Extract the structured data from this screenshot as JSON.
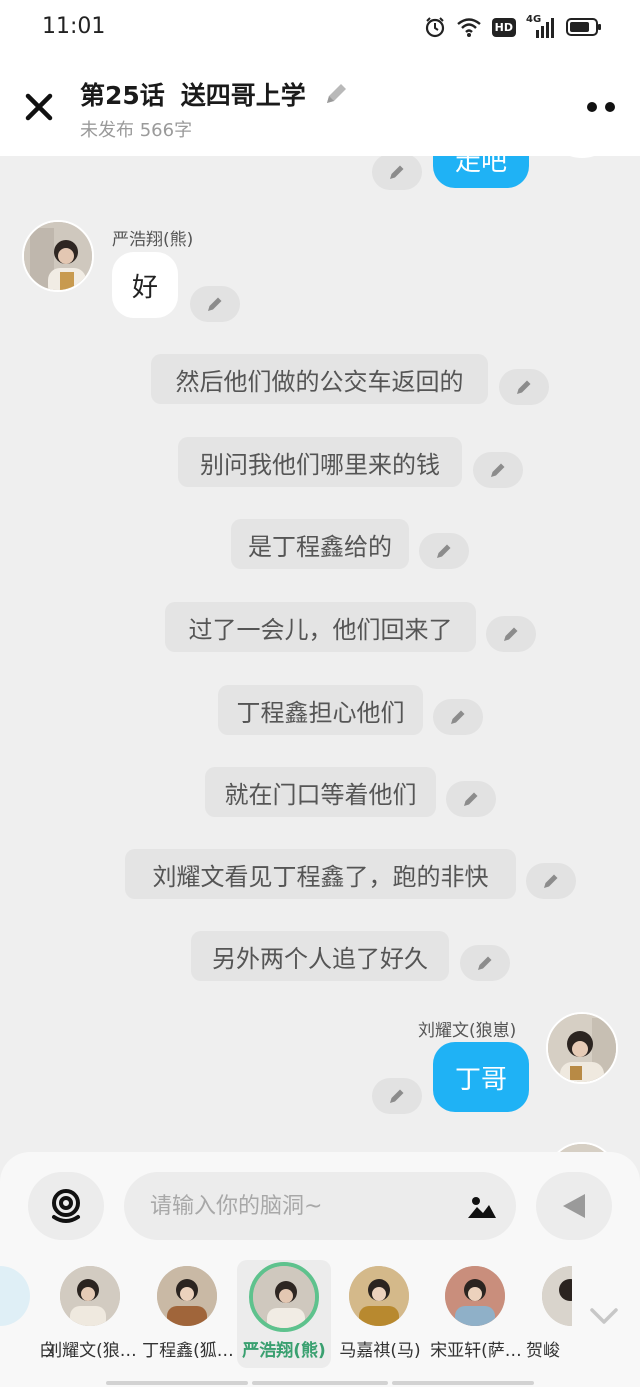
{
  "status_bar": {
    "time": "11:01",
    "hd_label": "HD",
    "network_label": "4G"
  },
  "header": {
    "title": "第25话",
    "episode_name": "送四哥上学",
    "subtitle": "未发布 566字"
  },
  "chat": {
    "top_partial_bubble": "走吧",
    "messages": [
      {
        "type": "character",
        "speaker": "严浩翔(熊)",
        "text": "好"
      },
      {
        "type": "narration",
        "text": "然后他们做的公交车返回的"
      },
      {
        "type": "narration",
        "text": "别问我他们哪里来的钱"
      },
      {
        "type": "narration",
        "text": "是丁程鑫给的"
      },
      {
        "type": "narration",
        "text": "过了一会儿，他们回来了"
      },
      {
        "type": "narration",
        "text": "丁程鑫担心他们"
      },
      {
        "type": "narration",
        "text": "就在门口等着他们"
      },
      {
        "type": "narration",
        "text": "刘耀文看见丁程鑫了，跑的非快"
      },
      {
        "type": "narration",
        "text": "另外两个人追了好久"
      },
      {
        "type": "character",
        "speaker": "刘耀文(狼崽)",
        "text": "丁哥"
      }
    ]
  },
  "composer": {
    "placeholder": "请输入你的脑洞~"
  },
  "characters": [
    {
      "name": "白",
      "selected": false
    },
    {
      "name": "刘耀文(狼…",
      "selected": false
    },
    {
      "name": "丁程鑫(狐…",
      "selected": false
    },
    {
      "name": "严浩翔(熊)",
      "selected": true
    },
    {
      "name": "马嘉祺(马)",
      "selected": false
    },
    {
      "name": "宋亚轩(萨…",
      "selected": false
    },
    {
      "name": "贺峻",
      "selected": false
    }
  ],
  "colors": {
    "blue_bubble": "#1fb2f5",
    "selected_ring": "#5ec28d",
    "background": "#efefef"
  }
}
